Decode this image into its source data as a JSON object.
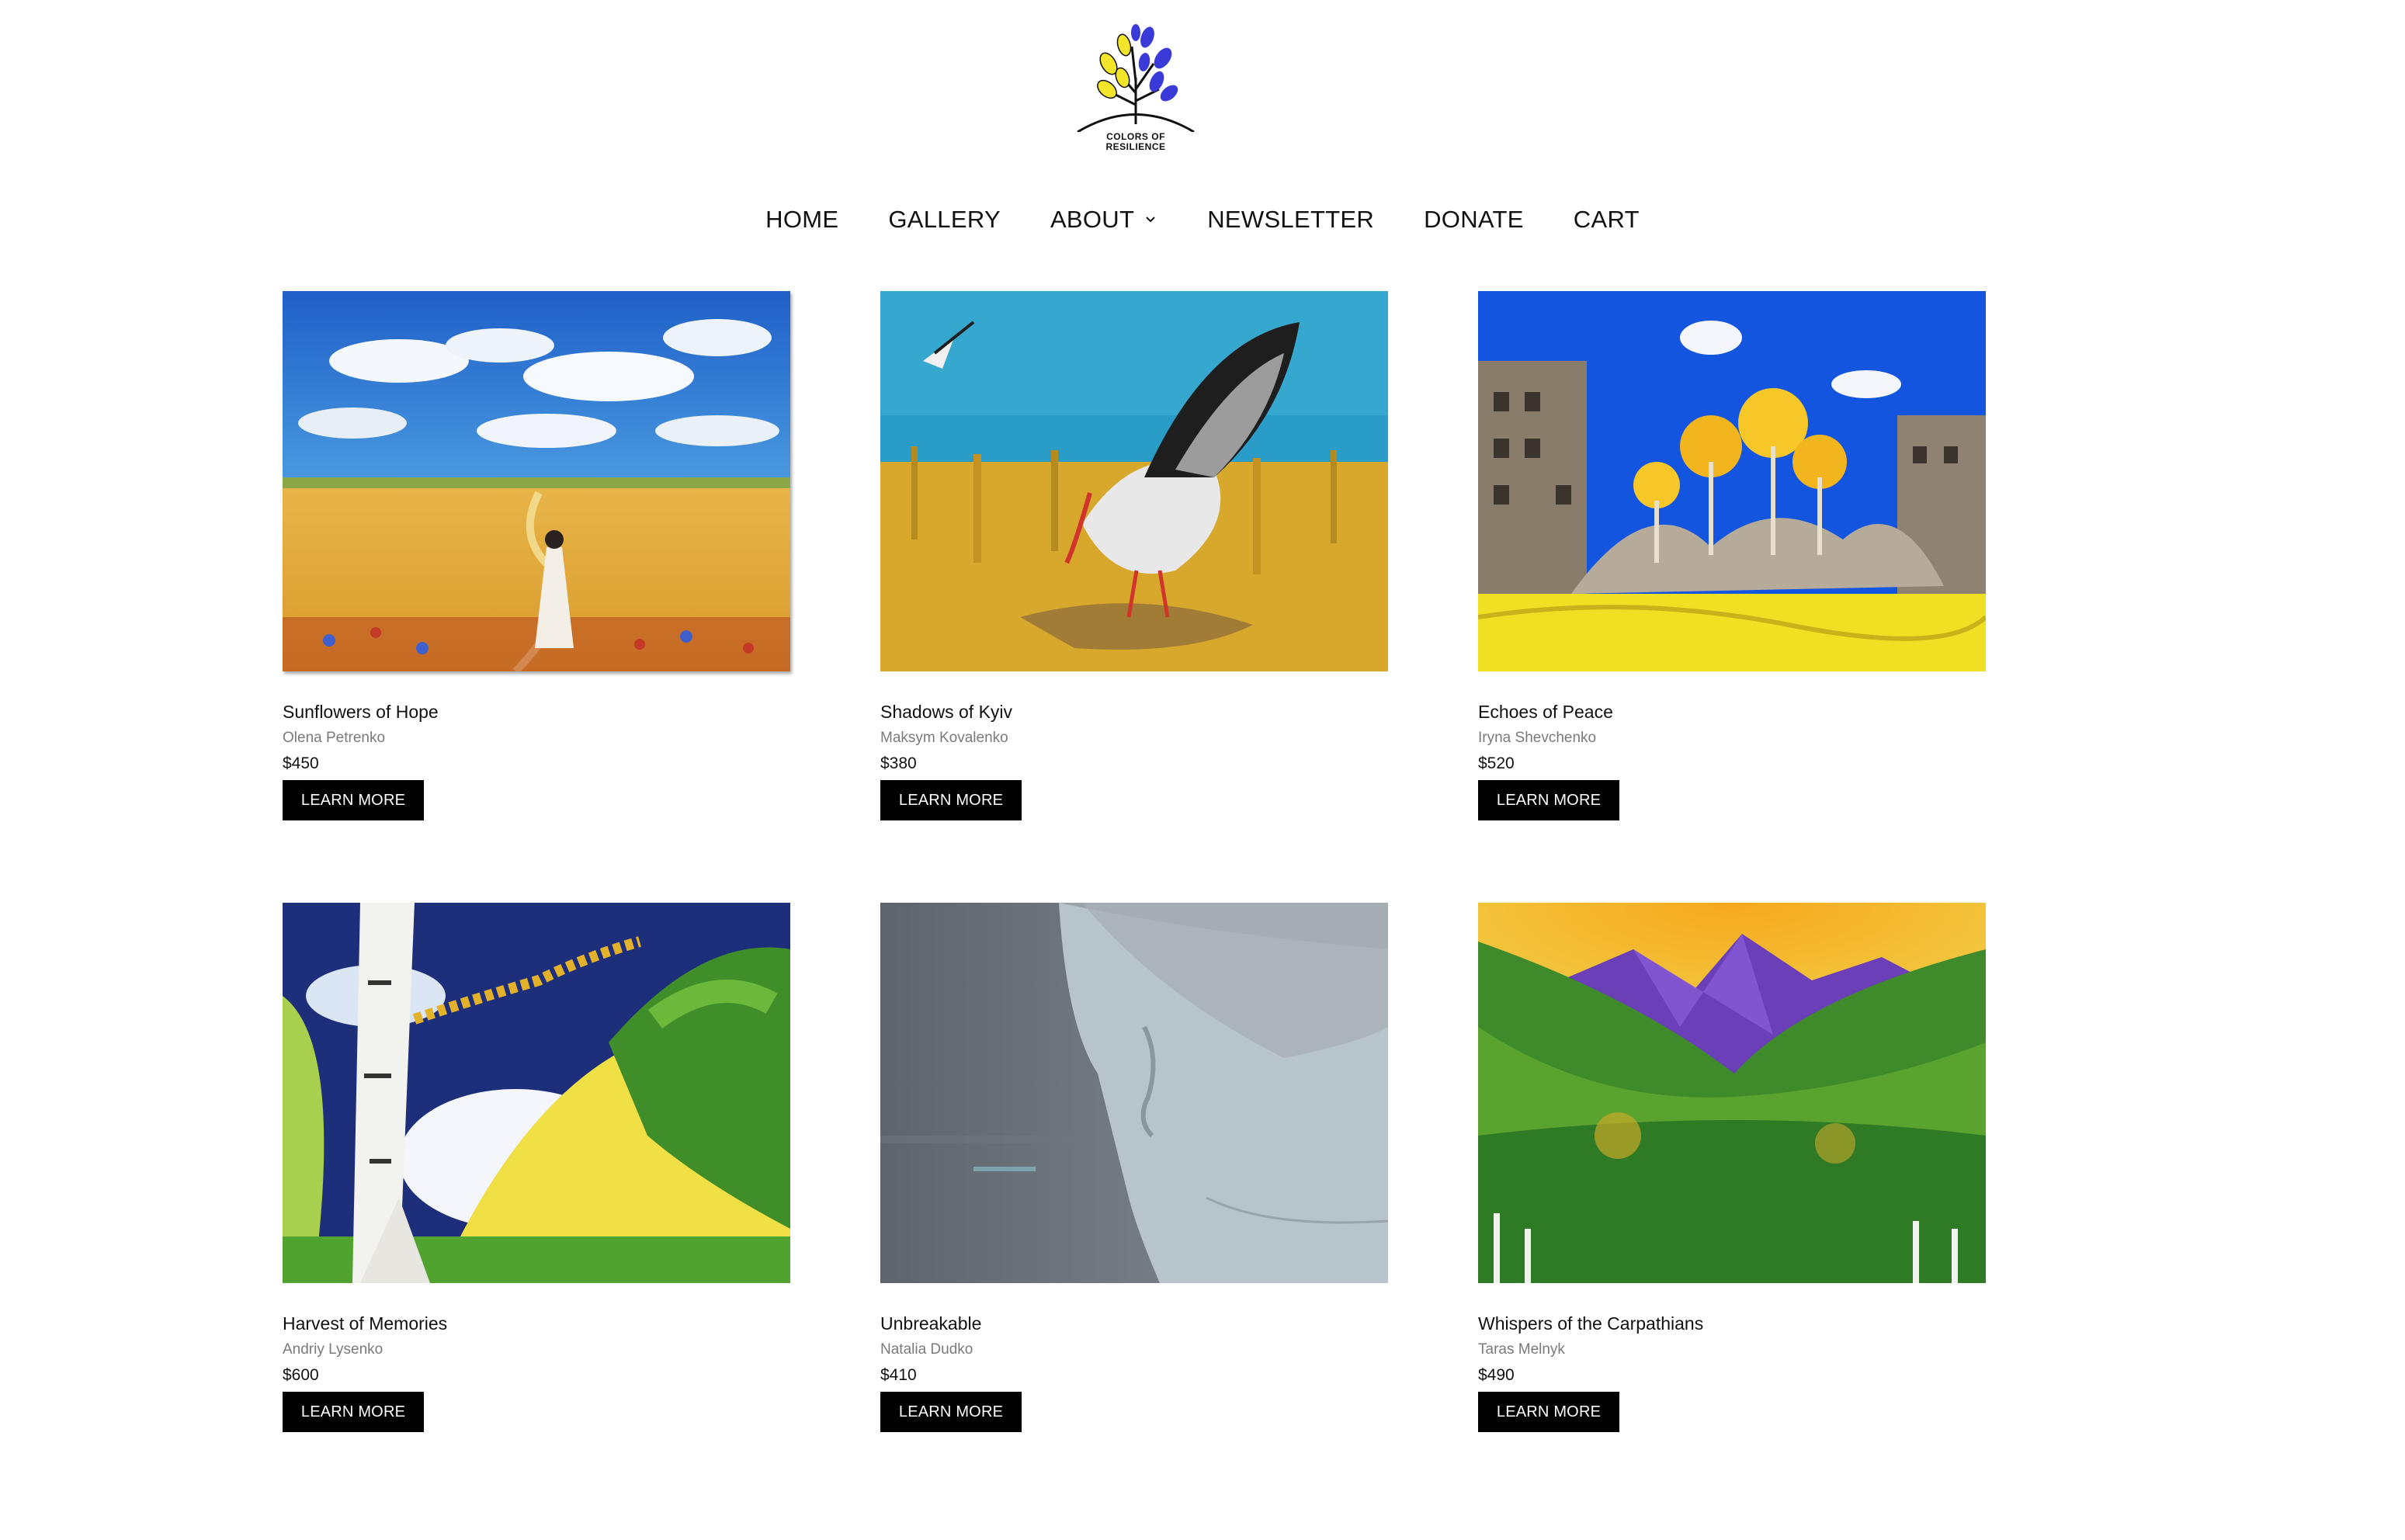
{
  "logo": {
    "line1": "COLORS OF",
    "line2": "RESILIENCE"
  },
  "nav": {
    "items": [
      {
        "label": "HOME"
      },
      {
        "label": "GALLERY"
      },
      {
        "label": "ABOUT",
        "icon": "chevron-down-icon"
      },
      {
        "label": "NEWSLETTER"
      },
      {
        "label": "DONATE"
      },
      {
        "label": "CART"
      }
    ]
  },
  "gallery": {
    "items": [
      {
        "title": "Sunflowers of Hope",
        "artist": "Olena Petrenko",
        "price": "$450",
        "button": "LEARN MORE"
      },
      {
        "title": "Shadows of Kyiv",
        "artist": "Maksym Kovalenko",
        "price": "$380",
        "button": "LEARN MORE"
      },
      {
        "title": "Echoes of Peace",
        "artist": "Iryna Shevchenko",
        "price": "$520",
        "button": "LEARN MORE"
      },
      {
        "title": "Harvest of Memories",
        "artist": "Andriy Lysenko",
        "price": "$600",
        "button": "LEARN MORE"
      },
      {
        "title": "Unbreakable",
        "artist": "Natalia Dudko",
        "price": "$410",
        "button": "LEARN MORE"
      },
      {
        "title": "Whispers of the Carpathians",
        "artist": "Taras Melnyk",
        "price": "$490",
        "button": "LEARN MORE"
      }
    ]
  },
  "colors": {
    "button_bg": "#000000",
    "artist_text": "#7a7a7a",
    "logo_blue": "#3a3ad8",
    "logo_yellow": "#f3e62a"
  }
}
